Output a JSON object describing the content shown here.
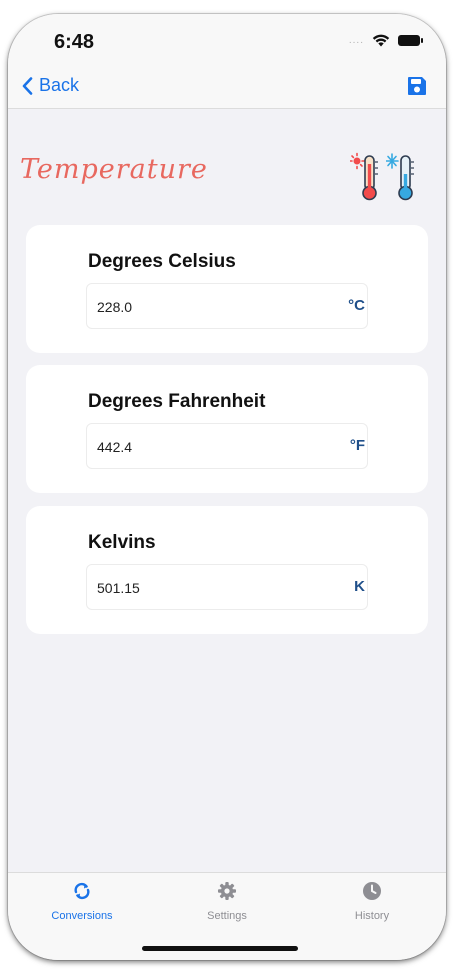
{
  "status": {
    "time": "6:48"
  },
  "nav": {
    "back_label": "Back"
  },
  "page": {
    "title": "Temperature"
  },
  "conversions": [
    {
      "label": "Degrees Celsius",
      "value": "228.0",
      "unit": "°C"
    },
    {
      "label": "Degrees Fahrenheit",
      "value": "442.4",
      "unit": "°F"
    },
    {
      "label": "Kelvins",
      "value": "501.15",
      "unit": "K"
    }
  ],
  "tabs": [
    {
      "label": "Conversions",
      "icon": "refresh-icon",
      "active": true
    },
    {
      "label": "Settings",
      "icon": "gear-icon",
      "active": false
    },
    {
      "label": "History",
      "icon": "clock-icon",
      "active": false
    }
  ],
  "colors": {
    "accent": "#1a73e8",
    "title": "#e8685f",
    "unit": "#1f4f8a",
    "background": "#f2f2f6"
  }
}
